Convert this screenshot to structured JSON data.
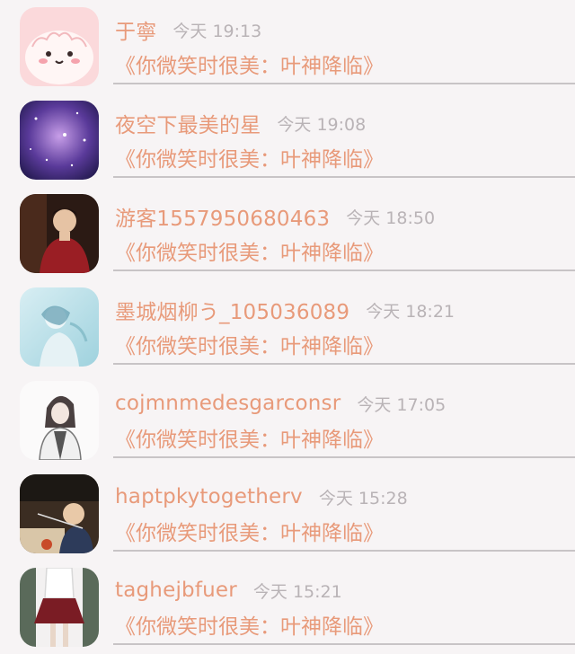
{
  "messages": [
    {
      "name": "于寧",
      "time": "今天 19:13",
      "text": "《你微笑时很美：叶神降临》",
      "avatar": "cartoon-mochi-icon"
    },
    {
      "name": "夜空下最美的星",
      "time": "今天 19:08",
      "text": "《你微笑时很美：叶神降临》",
      "avatar": "galaxy-icon"
    },
    {
      "name": "游客1557950680463",
      "time": "今天 18:50",
      "text": "《你微笑时很美：叶神降临》",
      "avatar": "performer-photo-icon"
    },
    {
      "name": "墨城烟柳う_105036089",
      "time": "今天 18:21",
      "text": "《你微笑时很美：叶神降临》",
      "avatar": "watercolor-girl-icon"
    },
    {
      "name": "cojmnmedesgarconsr",
      "time": "今天 17:05",
      "text": "《你微笑时很美：叶神降临》",
      "avatar": "anime-character-icon"
    },
    {
      "name": "haptpkytogetherv",
      "time": "今天 15:28",
      "text": "《你微笑时很美：叶神降临》",
      "avatar": "child-photo-icon"
    },
    {
      "name": "taghejbfuer",
      "time": "今天 15:21",
      "text": "《你微笑时很美：叶神降临》",
      "avatar": "skirt-outfit-icon"
    }
  ]
}
